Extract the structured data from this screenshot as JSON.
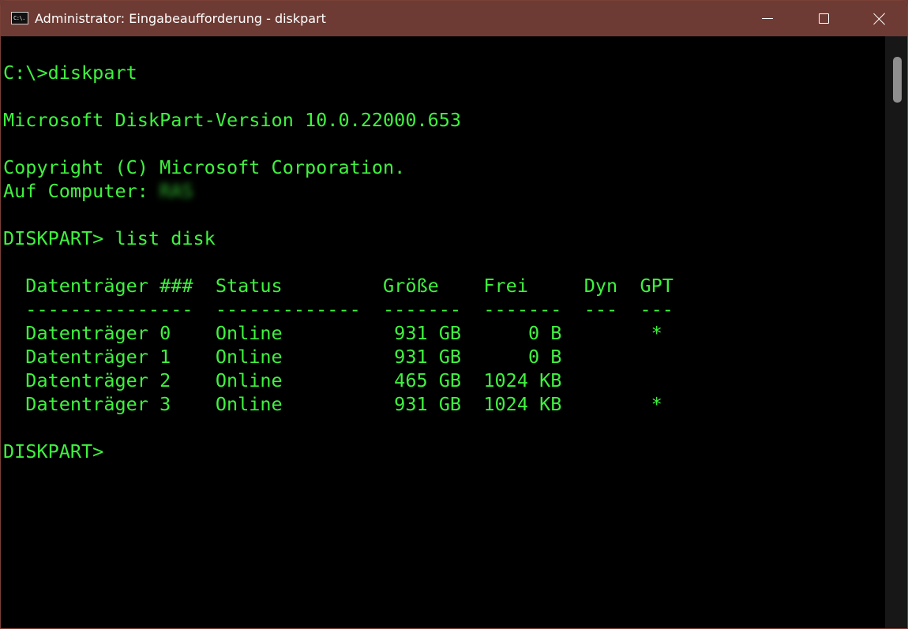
{
  "window": {
    "title": "Administrator: Eingabeaufforderung - diskpart",
    "app_icon_text": "C:\\.",
    "controls": {
      "minimize": "minimize-icon",
      "maximize": "maximize-icon",
      "close": "close-icon"
    }
  },
  "console": {
    "lines": {
      "cmd_diskpart": "C:\\>diskpart",
      "version": "Microsoft DiskPart-Version 10.0.22000.653",
      "copyright": "Copyright (C) Microsoft Corporation.",
      "computer_label": "Auf Computer: ",
      "computer_name": "RAS",
      "cmd_list_disk": "DISKPART> list disk",
      "table_header": "  Datenträger ###  Status         Größe    Frei     Dyn  GPT",
      "table_separator": "  ---------------  -------------  -------  -------  ---  ---",
      "rows": [
        "  Datenträger 0    Online          931 GB      0 B        *",
        "  Datenträger 1    Online          931 GB      0 B",
        "  Datenträger 2    Online          465 GB  1024 KB",
        "  Datenträger 3    Online          931 GB  1024 KB        *"
      ],
      "prompt": "DISKPART>"
    },
    "text_color": "#3ff23f",
    "background_color": "#000000"
  },
  "titlebar_color": "#6e3b34"
}
